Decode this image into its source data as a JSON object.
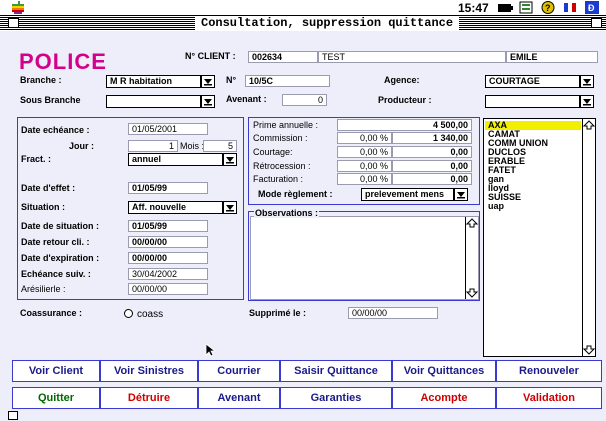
{
  "window": {
    "title": "Consultation, suppression  quittance"
  },
  "menubar": {
    "clock": "15:47"
  },
  "header": {
    "app_label": "POLICE",
    "client_label": "N° CLIENT :",
    "client_number": "002634",
    "client_name": "TEST",
    "client_firstname": "EMILE"
  },
  "policy": {
    "branche_label": "Branche :",
    "branche_value": "M R habitation",
    "number_label": "N°",
    "number_value": "10/5C",
    "agence_label": "Agence:",
    "agence_value": "COURTAGE",
    "sous_branche_label": "Sous Branche",
    "sous_branche_value": "",
    "avenant_label": "Avenant :",
    "avenant_value": "0",
    "producteur_label": "Producteur :",
    "producteur_value": ""
  },
  "dates": {
    "echeance_label": "Date echéance :",
    "echeance_value": "01/05/2001",
    "jour_label": "Jour :",
    "jour_value": "1",
    "mois_label": "Mois :",
    "mois_value": "5",
    "fract_label": "Fract. :",
    "fract_value": "annuel",
    "effet_label": "Date d'effet :",
    "effet_value": "01/05/99",
    "situation_label": "Situation :",
    "situation_value": "Aff. nouvelle",
    "date_situation_label": "Date de situation :",
    "date_situation_value": "01/05/99",
    "retour_label": "Date retour cli. :",
    "retour_value": "00/00/00",
    "expiration_label": "Date d'expiration :",
    "expiration_value": "00/00/00",
    "echeance_suiv_label": "Echéance suiv. :",
    "echeance_suiv_value": "30/04/2002",
    "resilie_label": "Arésilierle :",
    "resilie_value": "00/00/00"
  },
  "premium": {
    "prime_label": "Prime annuelle :",
    "prime_value": "4 500,00",
    "commission_label": "Commission :",
    "commission_pct": "0,00 %",
    "commission_value": "1 340,00",
    "courtage_label": "Courtage:",
    "courtage_pct": "0,00 %",
    "courtage_value": "0,00",
    "retrocession_label": "Rétrocession :",
    "retrocession_pct": "0,00 %",
    "retrocession_value": "0,00",
    "facturation_label": "Facturation :",
    "facturation_pct": "0,00 %",
    "facturation_value": "0,00",
    "mode_label": "Mode règlement :",
    "mode_value": "prelevement mens"
  },
  "observations": {
    "label": "Observations :"
  },
  "insurers": [
    "AXA",
    "CAMAT",
    "COMM UNION",
    "DUCLOS",
    "ERABLE",
    "FATET",
    "gan",
    "lloyd",
    "SUISSE",
    "uap"
  ],
  "footer": {
    "coassurance_label": "Coassurance :",
    "coass_option": "coass",
    "supprime_label": "Supprimé le :",
    "supprime_value": "00/00/00"
  },
  "buttons": {
    "voir_client": "Voir Client",
    "voir_sinistres": "Voir Sinistres",
    "courrier": "Courrier",
    "saisir_quittance": "Saisir Quittance",
    "voir_quittances": "Voir Quittances",
    "renouveler": "Renouveler",
    "quitter": "Quitter",
    "detruire": "Détruire",
    "avenant": "Avenant",
    "garanties": "Garanties",
    "acompte": "Acompte",
    "validation": "Validation"
  },
  "colors": {
    "accent": "#d4008a",
    "panel_border": "#3a3ad0",
    "selection": "#f2f000"
  }
}
